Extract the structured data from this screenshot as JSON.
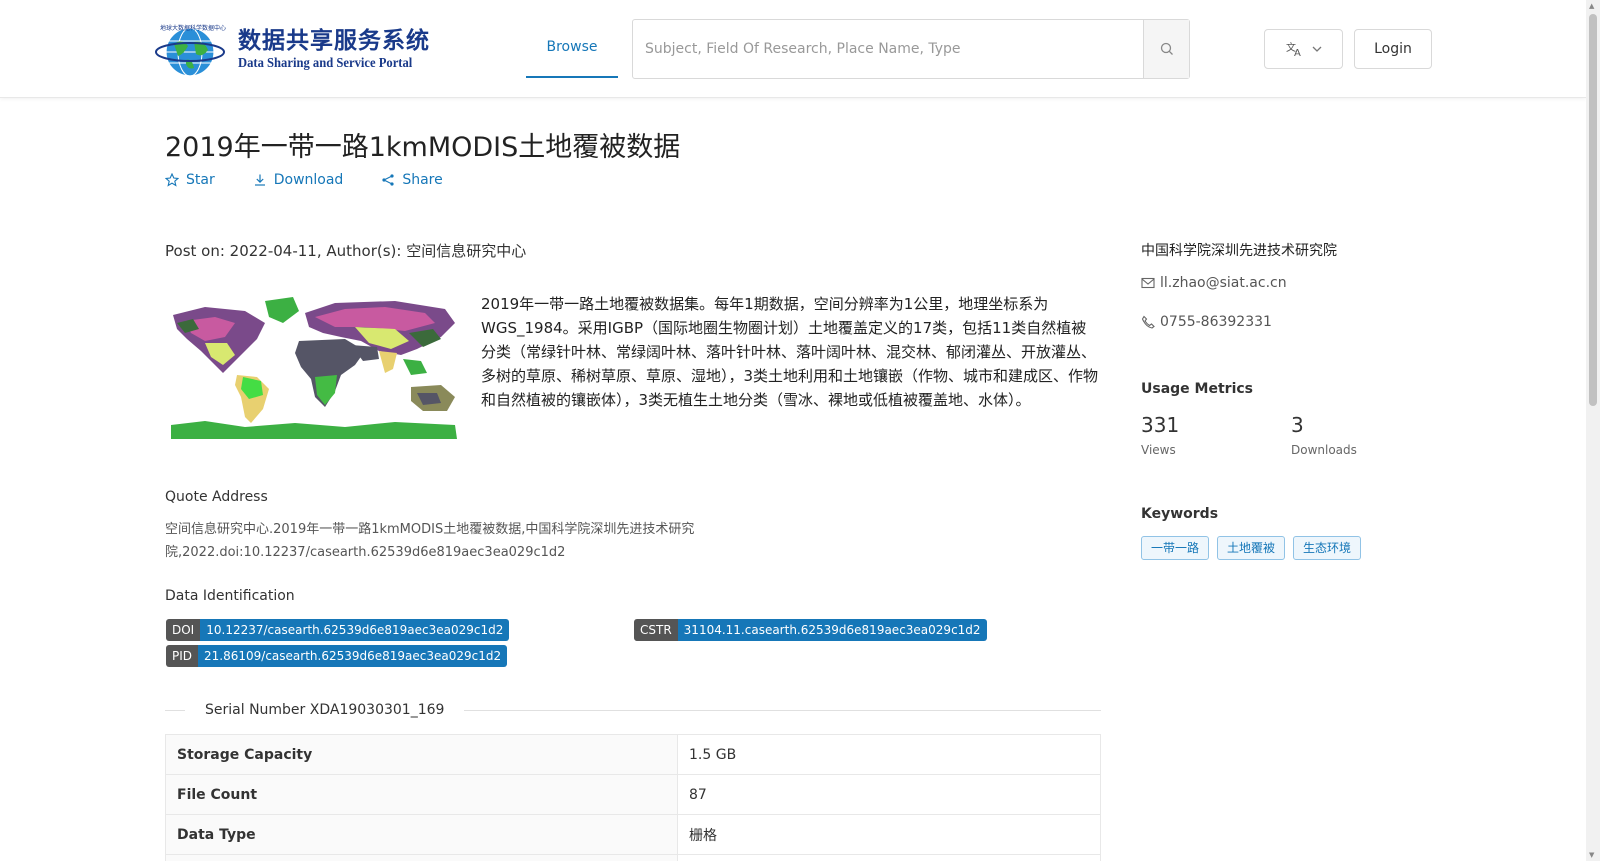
{
  "header": {
    "logo_cn": "数据共享服务系统",
    "logo_en": "Data Sharing and Service Portal",
    "nav_browse": "Browse",
    "search_placeholder": "Subject, Field Of Research, Place Name, Type",
    "login": "Login"
  },
  "dataset": {
    "title": "2019年一带一路1kmMODIS土地覆被数据",
    "actions": {
      "star": "Star",
      "download": "Download",
      "share": "Share"
    },
    "post_on": "Post on: 2022-04-11, Author(s): 空间信息研究中心",
    "description": "2019年一带一路土地覆被数据集。每年1期数据，空间分辨率为1公里，地理坐标系为WGS_1984。采用IGBP（国际地圈生物圈计划）土地覆盖定义的17类，包括11类自然植被分类（常绿针叶林、常绿阔叶林、落叶针叶林、落叶阔叶林、混交林、郁闭灌丛、开放灌丛、多树的草原、稀树草原、草原、湿地），3类土地利用和土地镶嵌（作物、城市和建成区、作物和自然植被的镶嵌体），3类无植生土地分类（雪冰、裸地或低植被覆盖地、水体）。",
    "quote_heading": "Quote Address",
    "quote_text": "空间信息研究中心.2019年一带一路1kmMODIS土地覆被数据,中国科学院深圳先进技术研究院,2022.doi:10.12237/casearth.62539d6e819aec3ea029c1d2",
    "ident_heading": "Data Identification",
    "identifiers": {
      "doi_key": "DOI",
      "doi": "10.12237/casearth.62539d6e819aec3ea029c1d2",
      "cstr_key": "CSTR",
      "cstr": "31104.11.casearth.62539d6e819aec3ea029c1d2",
      "pid_key": "PID",
      "pid": "21.86109/casearth.62539d6e819aec3ea029c1d2"
    },
    "serial": "Serial Number XDA19030301_169",
    "info": [
      {
        "key": "Storage Capacity",
        "value": "1.5 GB"
      },
      {
        "key": "File Count",
        "value": "87"
      },
      {
        "key": "Data Type",
        "value": "栅格"
      }
    ]
  },
  "sidebar": {
    "institution": "中国科学院深圳先进技术研究院",
    "email": "ll.zhao@siat.ac.cn",
    "phone": "0755-86392331",
    "metrics_heading": "Usage Metrics",
    "views_value": "331",
    "views_label": "Views",
    "downloads_value": "3",
    "downloads_label": "Downloads",
    "keywords_heading": "Keywords",
    "keywords": [
      "一带一路",
      "土地覆被",
      "生态环境"
    ]
  },
  "colors": {
    "accent": "#1677b8",
    "badge_key": "#555555"
  }
}
